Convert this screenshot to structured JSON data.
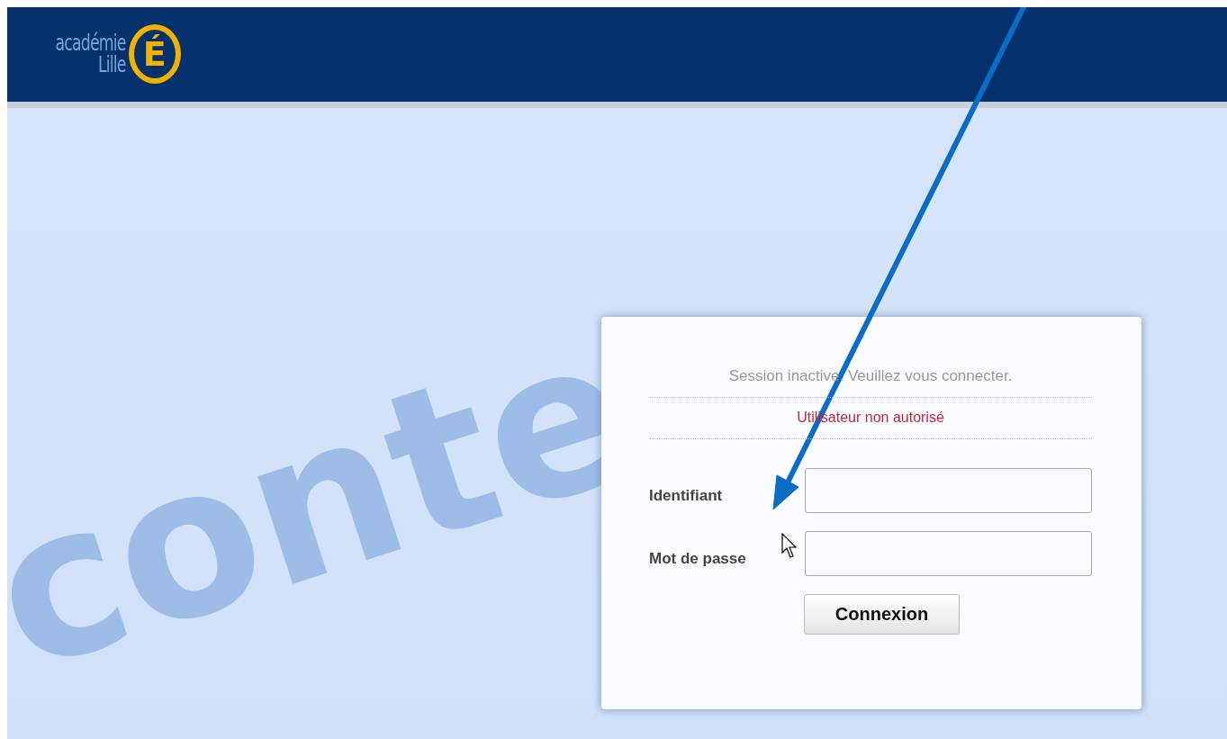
{
  "header": {
    "logo": {
      "line1": "académie",
      "line2": "Lille",
      "mark": "É"
    }
  },
  "background_text": "conte",
  "login": {
    "message": "Session inactive. Veuillez vous connecter.",
    "error": "Utilisateur non autorisé",
    "fields": [
      {
        "label": "Identifiant"
      },
      {
        "label": "Mot de passe"
      }
    ],
    "button": "Connexion"
  }
}
